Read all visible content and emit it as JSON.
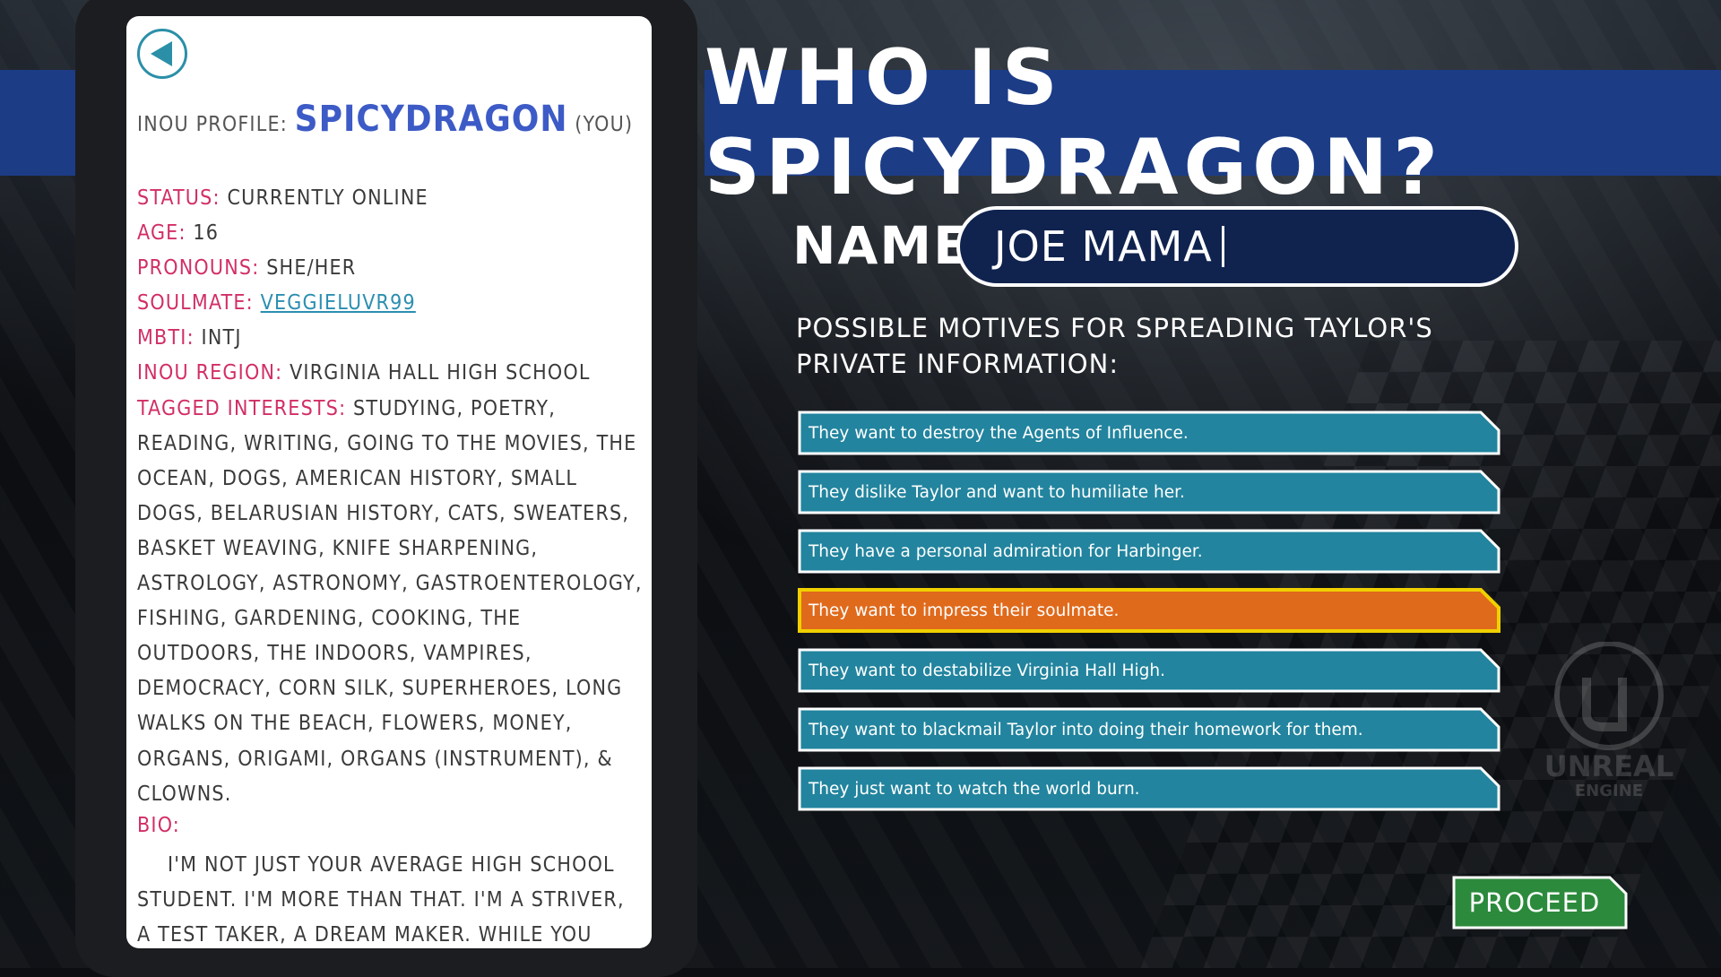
{
  "title": "WHO IS SPICYDRAGON?",
  "profile": {
    "label": "INOU PROFILE:",
    "username": "SPICYDRAGON",
    "you": "(YOU)",
    "status_key": "STATUS:",
    "status_val": "CURRENTLY ONLINE",
    "age_key": "AGE:",
    "age_val": "16",
    "pronouns_key": "PRONOUNS:",
    "pronouns_val": "SHE/HER",
    "soulmate_key": "SOULMATE:",
    "soulmate_val": "VEGGIELUVR99",
    "mbti_key": "MBTI:",
    "mbti_val": "INTJ",
    "region_key": "INOU REGION:",
    "region_val": "VIRGINIA HALL HIGH SCHOOL",
    "interests_key": "TAGGED INTERESTS:",
    "interests_val": "STUDYING, POETRY, READING, WRITING, GOING TO THE MOVIES, THE OCEAN, DOGS, AMERICAN HISTORY, SMALL DOGS, BELARUSIAN HISTORY, CATS, SWEATERS, BASKET WEAVING, KNIFE SHARPENING, ASTROLOGY, ASTRONOMY, GASTROENTEROLOGY, FISHING, GARDENING, COOKING, THE OUTDOORS, THE INDOORS, VAMPIRES, DEMOCRACY, CORN SILK, SUPERHEROES, LONG WALKS ON THE BEACH, FLOWERS, MONEY, ORGANS, ORIGAMI, ORGANS (INSTRUMENT), & CLOWNS.",
    "bio_key": "BIO:",
    "bio_val": "I'M NOT JUST YOUR AVERAGE HIGH SCHOOL STUDENT. I'M MORE THAN THAT. I'M A STRIVER, A TEST TAKER, A DREAM MAKER. WHILE YOU SLEPT, I GRINDED. WHILE YOU PARTIED, I"
  },
  "name_label": "NAME:",
  "name_value": "JOE MAMA",
  "motives_prompt": "POSSIBLE MOTIVES FOR SPREADING TAYLOR'S PRIVATE INFORMATION:",
  "options": [
    "They want to destroy the Agents of Influence.",
    "They dislike Taylor and want to humiliate her.",
    "They have a personal admiration for Harbinger.",
    "They want to impress their soulmate.",
    "They want to destabilize Virginia Hall High.",
    "They want to blackmail Taylor into doing their homework for them.",
    "They just want to watch the world burn."
  ],
  "selected_option": 3,
  "proceed_label": "PROCEED",
  "logo_text": "UNREAL",
  "logo_subtext": "ENGINE",
  "colors": {
    "banner": "#1c3c86",
    "option": "#22849e",
    "option_selected": "#e06a1c",
    "selected_border": "#f0d000",
    "profile_key": "#d22e67",
    "username": "#3d5bc6",
    "proceed": "#2c8a3c"
  },
  "icons": {
    "back": "back-arrow-icon",
    "logo": "unreal-engine-logo"
  }
}
